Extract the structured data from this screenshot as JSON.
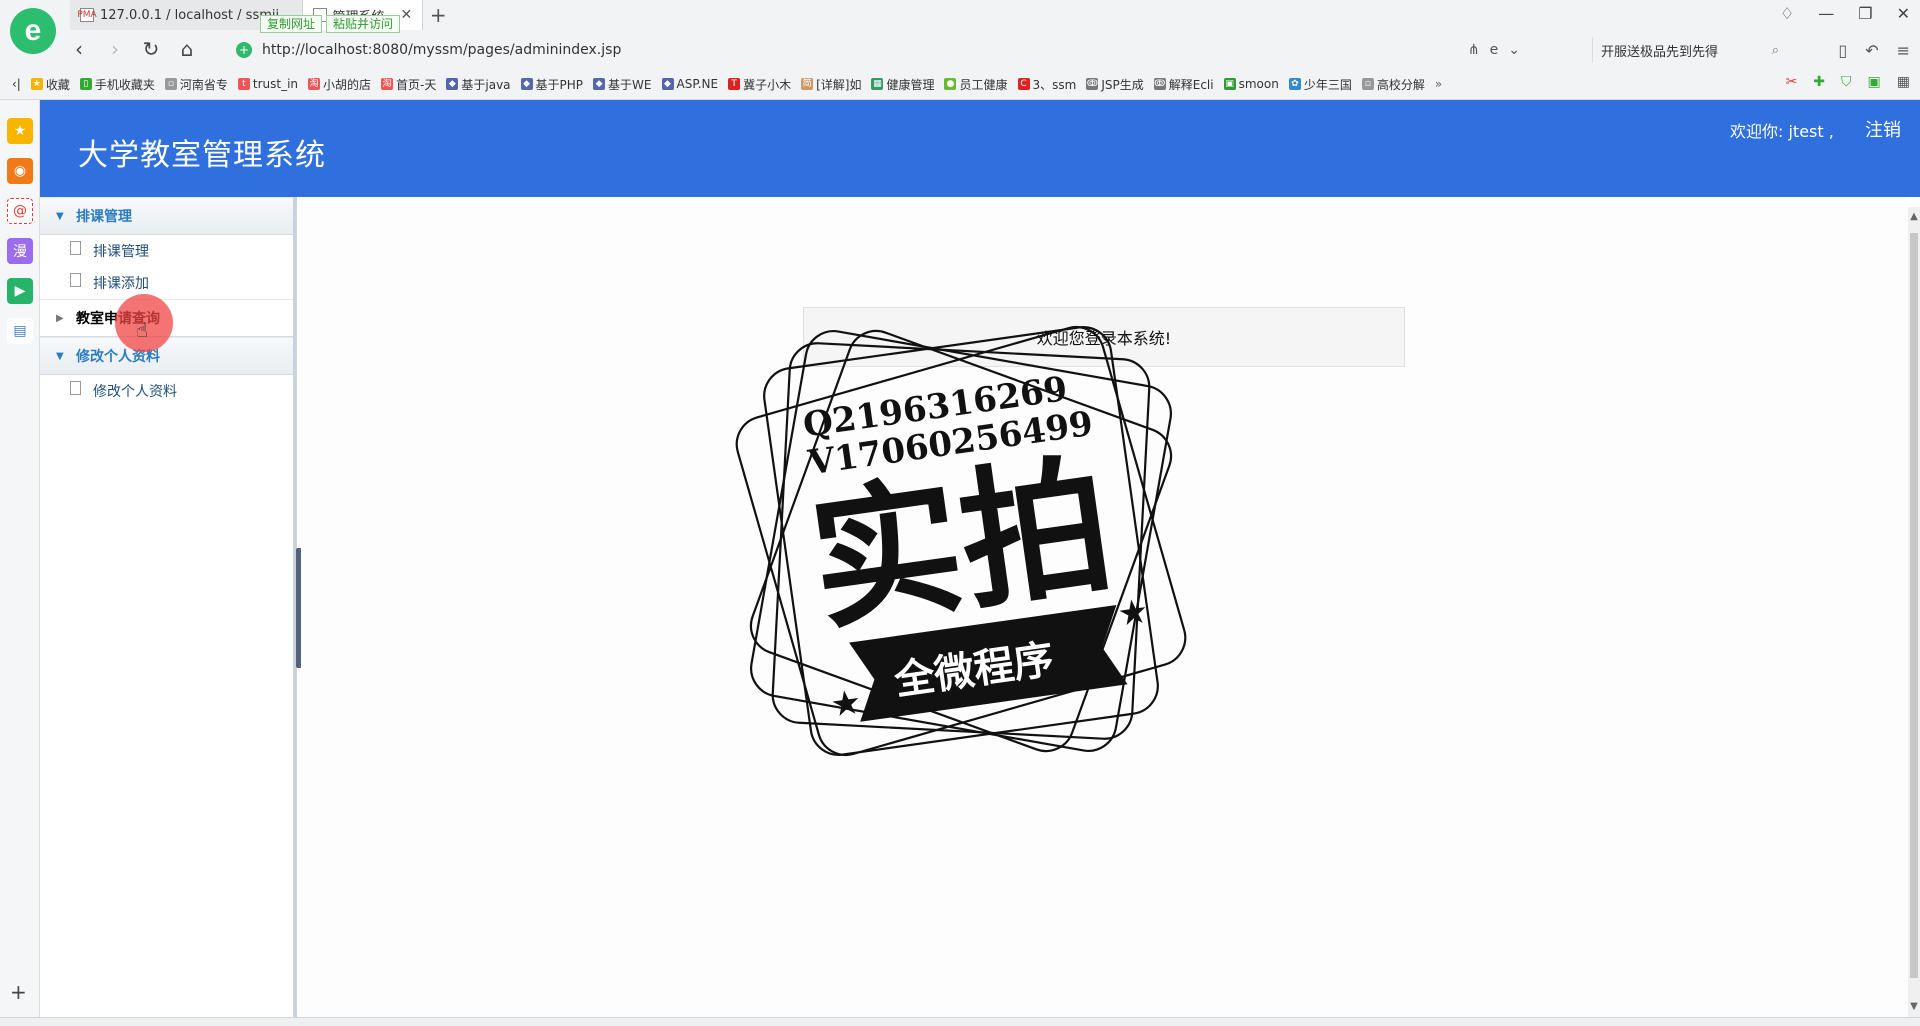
{
  "browser": {
    "logo_letter": "e",
    "tabs": [
      {
        "label": "127.0.0.1 / localhost / ssmji...",
        "favicon": "PMA",
        "active": false
      },
      {
        "label": "管理系统",
        "favicon": "",
        "active": true
      }
    ],
    "tab_tools": {
      "copy": "复制网址",
      "paste": "粘贴并访问"
    },
    "address": "http://localhost:8080/myssm/pages/adminindex.jsp",
    "search_text": "开服送极品先到先得",
    "bookmarks": [
      "收藏",
      "手机收藏夹",
      "河南省专",
      "trust_in",
      "小胡的店",
      "首页-天",
      "基于java",
      "基于PHP",
      "基于WE",
      "ASP.NE",
      "冀子小木",
      "[详解]如",
      "健康管理",
      "员工健康",
      "3、ssm",
      "JSP生成",
      "解释Ecli",
      "smoon",
      "少年三国",
      "高校分解"
    ],
    "bookmark_more": "»"
  },
  "app": {
    "title": "大学教室管理系统",
    "welcome": "欢迎你: jtest ,",
    "logout": "注销",
    "menu": [
      {
        "header": "排课管理",
        "expanded": true,
        "items": [
          "排课管理",
          "排课添加"
        ]
      },
      {
        "header": "教室申请查询",
        "expanded": false,
        "items": []
      },
      {
        "header": "修改个人资料",
        "expanded": true,
        "items": [
          "修改个人资料"
        ]
      }
    ],
    "welcome_panel": "欢迎您登录本系统!"
  },
  "watermark": {
    "line1": "Q2196316269",
    "line2": "V17060256499",
    "big": "实拍",
    "banner": "全微程序"
  },
  "colors": {
    "header_blue": "#2f6fde",
    "menu_blue": "#2b7bc0",
    "link_navy": "#1f4e79"
  }
}
